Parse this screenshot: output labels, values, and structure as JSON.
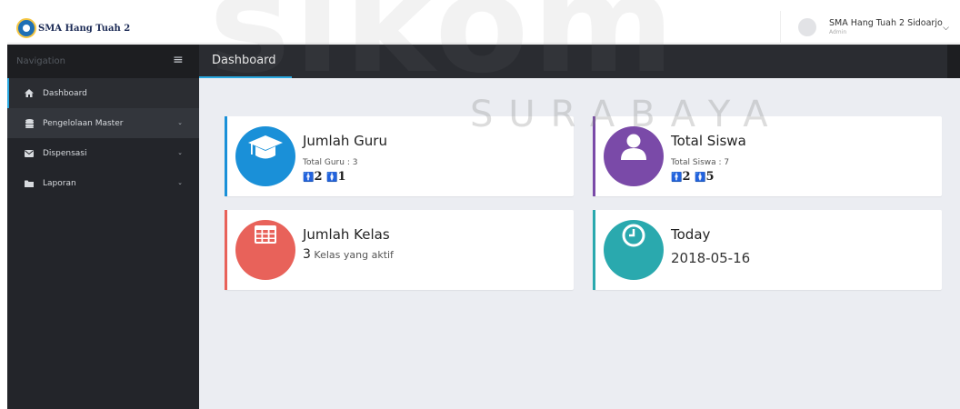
{
  "header": {
    "logo_text": "SMA Hang Tuah 2",
    "user_name": "SMA Hang Tuah 2 Sidoarjo",
    "user_role": "Admin"
  },
  "nav": {
    "label": "Navigation",
    "page_title": "Dashboard"
  },
  "sidebar": {
    "items": [
      {
        "label": "Dashboard",
        "icon": "home-icon",
        "active": true
      },
      {
        "label": "Pengelolaan Master",
        "icon": "database-icon",
        "has_submenu": true
      },
      {
        "label": "Dispensasi",
        "icon": "envelope-icon",
        "has_submenu": true
      },
      {
        "label": "Laporan",
        "icon": "folder-icon",
        "has_submenu": true
      }
    ]
  },
  "cards": {
    "guru": {
      "title": "Jumlah Guru",
      "subtitle": "Total Guru : 3",
      "male": "2",
      "female": "1",
      "color": "#1a90d8",
      "icon": "graduation-cap-icon"
    },
    "siswa": {
      "title": "Total Siswa",
      "subtitle": "Total Siswa : 7",
      "male": "2",
      "female": "5",
      "color": "#7a4aa8",
      "icon": "user-icon"
    },
    "kelas": {
      "title": "Jumlah Kelas",
      "count": "3",
      "suffix": "Kelas yang aktif",
      "color": "#e8625a",
      "icon": "table-icon"
    },
    "today": {
      "title": "Today",
      "date": "2018-05-16",
      "color": "#2aa9ae",
      "icon": "clock-icon"
    }
  },
  "watermark": {
    "big": "sikom",
    "small": "SURABAYA"
  },
  "colors": {
    "accent": "#29a8e0",
    "sidebar_bg": "#23252a",
    "content_bg": "#ebedf2"
  }
}
